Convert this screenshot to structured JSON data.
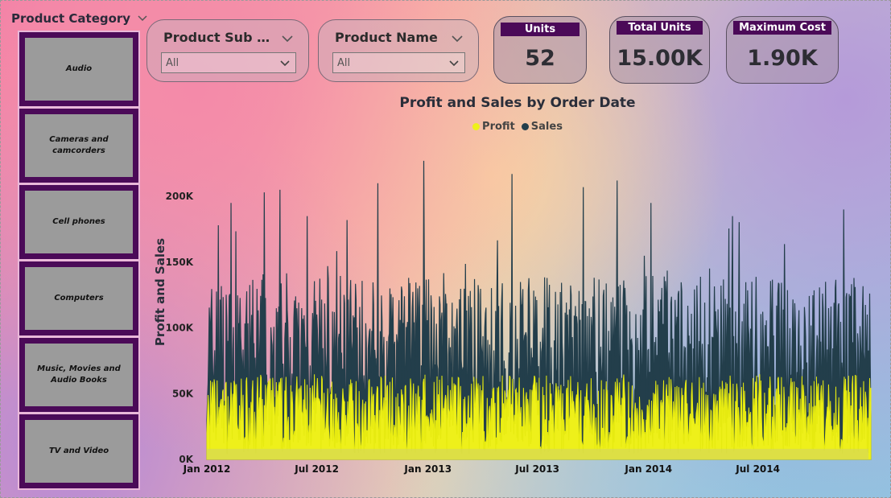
{
  "category_slicer": {
    "title": "Product Category",
    "items": [
      {
        "label": "Audio"
      },
      {
        "label": "Cameras and camcorders"
      },
      {
        "label": "Cell phones"
      },
      {
        "label": "Computers"
      },
      {
        "label": "Music, Movies and Audio Books"
      },
      {
        "label": "TV and Video"
      }
    ],
    "colors": {
      "tile_border": "#4b0a58",
      "tile_fill": "#9b9b9b"
    }
  },
  "sub_category_slicer": {
    "title": "Product Sub C...",
    "value": "All"
  },
  "product_name_slicer": {
    "title": "Product Name",
    "value": "All"
  },
  "cards": {
    "units": {
      "label": "Units",
      "value": "52"
    },
    "total_units": {
      "label": "Total Units",
      "value": "15.00K"
    },
    "maximum_cost": {
      "label": "Maximum Cost",
      "value": "1.90K"
    }
  },
  "chart_data": {
    "type": "area",
    "title": "Profit and Sales by Order Date",
    "ylabel": "Profit and Sales",
    "xlabel": "",
    "x_range": [
      "2012-01-01",
      "2014-12-31"
    ],
    "x_ticks": [
      "Jan 2012",
      "Jul 2012",
      "Jan 2013",
      "Jul 2013",
      "Jan 2014",
      "Jul 2014"
    ],
    "y_ticks": [
      "0K",
      "50K",
      "100K",
      "150K",
      "200K"
    ],
    "ylim": [
      0,
      230000
    ],
    "legend_position": "top-center",
    "series": [
      {
        "name": "Profit",
        "color": "#eef01a",
        "typical_min": 15000,
        "typical_max": 65000
      },
      {
        "name": "Sales",
        "color": "#233e4b",
        "typical_min": 30000,
        "typical_max": 140000
      }
    ],
    "sales_peaks": [
      {
        "date": "2012-01-20",
        "value": 178000
      },
      {
        "date": "2012-02-10",
        "value": 195000
      },
      {
        "date": "2012-04-05",
        "value": 203000
      },
      {
        "date": "2012-05-01",
        "value": 205000
      },
      {
        "date": "2012-06-15",
        "value": 185000
      },
      {
        "date": "2012-08-20",
        "value": 182000
      },
      {
        "date": "2012-10-10",
        "value": 210000
      },
      {
        "date": "2012-12-25",
        "value": 227000
      },
      {
        "date": "2013-05-20",
        "value": 217000
      },
      {
        "date": "2013-09-15",
        "value": 207000
      },
      {
        "date": "2013-11-10",
        "value": 212000
      },
      {
        "date": "2014-01-05",
        "value": 195000
      },
      {
        "date": "2014-05-20",
        "value": 185000
      },
      {
        "date": "2014-11-20",
        "value": 190000
      }
    ]
  }
}
